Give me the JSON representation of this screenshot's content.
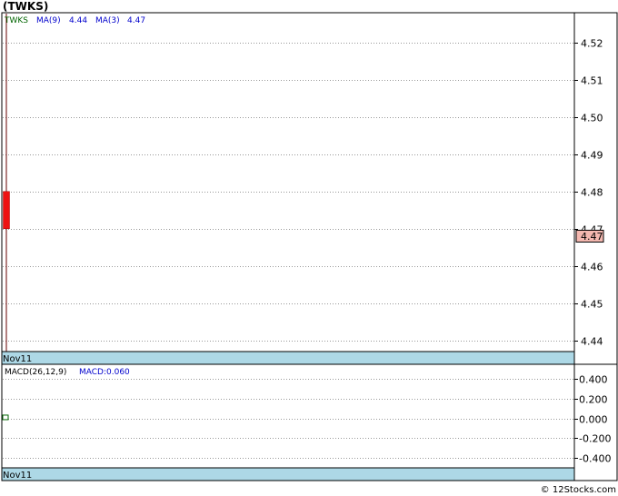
{
  "title": "(TWKS)",
  "footer": "© 12Stocks.com",
  "chart_data": [
    {
      "type": "candlestick",
      "legend": [
        {
          "text": "TWKS",
          "color": "#006400"
        },
        {
          "text": "MA(9)",
          "color": "#0000cc"
        },
        {
          "text": "4.44",
          "color": "#0000cc"
        },
        {
          "text": "MA(3)",
          "color": "#0000cc"
        },
        {
          "text": "4.47",
          "color": "#0000cc"
        }
      ],
      "x_label": "Nov11",
      "ylim": [
        4.437,
        4.528
      ],
      "yticks": [
        {
          "value": 4.44,
          "label": "4.44"
        },
        {
          "value": 4.45,
          "label": "4.45"
        },
        {
          "value": 4.46,
          "label": "4.46"
        },
        {
          "value": 4.47,
          "label": "4.47"
        },
        {
          "value": 4.48,
          "label": "4.48"
        },
        {
          "value": 4.49,
          "label": "4.49"
        },
        {
          "value": 4.5,
          "label": "4.50"
        },
        {
          "value": 4.51,
          "label": "4.51"
        },
        {
          "value": 4.52,
          "label": "4.52"
        }
      ],
      "candles": [
        {
          "open": 4.48,
          "close": 4.47,
          "high": 4.53,
          "low": 4.437
        }
      ],
      "last_price": {
        "value": 4.468,
        "label": "4.47"
      },
      "colors": {
        "candle": "#ee1111",
        "wick": "#660000",
        "grid": "#999999",
        "axis_bar": "#add8e6",
        "price_tag_fill": "#f4b8b0"
      }
    },
    {
      "type": "bar",
      "legend": [
        {
          "text": "MACD(26,12,9)",
          "color": "#000000"
        },
        {
          "text": "MACD:0.060",
          "color": "#0000cc"
        }
      ],
      "x_label": "Nov11",
      "ylim": [
        -0.5,
        0.55
      ],
      "yticks": [
        {
          "value": 0.4,
          "label": "0.400"
        },
        {
          "value": 0.2,
          "label": "0.200"
        },
        {
          "value": 0.0,
          "label": "0.000"
        },
        {
          "value": -0.2,
          "label": "-0.200"
        },
        {
          "value": -0.4,
          "label": "-0.400"
        }
      ],
      "values": [
        0.03
      ],
      "colors": {
        "bar": "#006400",
        "grid": "#999999",
        "axis_bar": "#add8e6"
      }
    }
  ]
}
